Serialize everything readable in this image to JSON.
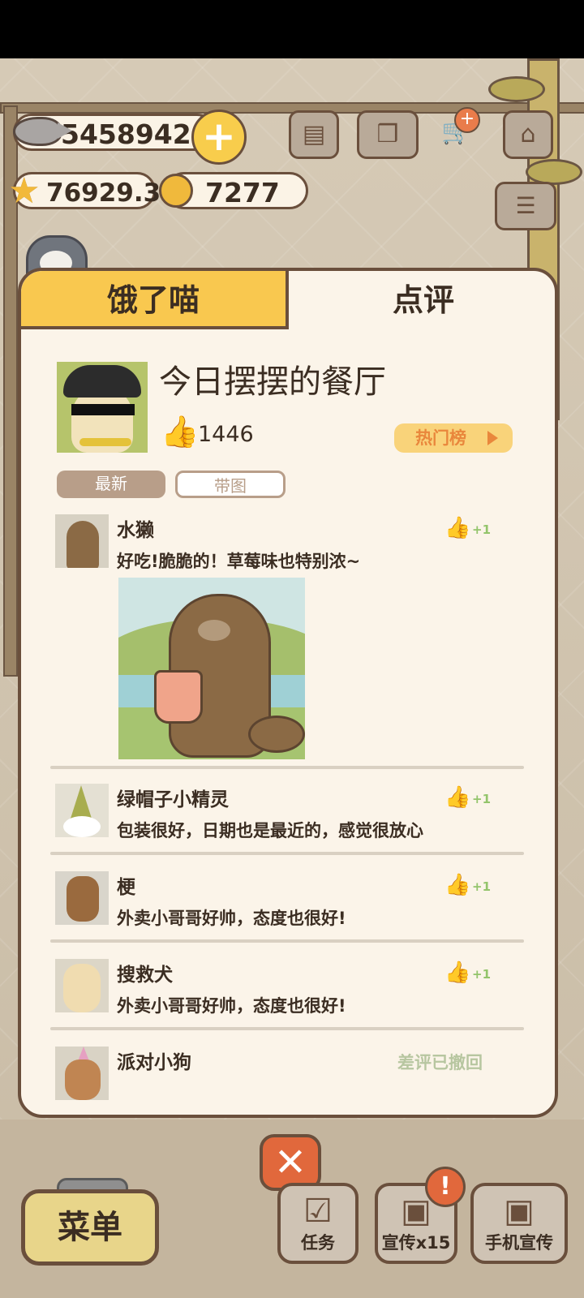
{
  "currency": {
    "fish": "5458942",
    "stars": "76929.3",
    "bells": "7277"
  },
  "tabs": {
    "left": "饿了喵",
    "right": "点评"
  },
  "restaurant": {
    "name": "今日摆摆的餐厅",
    "likes": "1446",
    "hot_list": "热门榜"
  },
  "filters": {
    "latest": "最新",
    "with_image": "带图"
  },
  "reviews": [
    {
      "name": "水獭",
      "text": "好吃!脆脆的！草莓味也特别浓~",
      "like": "+1",
      "has_photo": true
    },
    {
      "name": "绿帽子小精灵",
      "text": "包装很好，日期也是最近的，感觉很放心",
      "like": "+1"
    },
    {
      "name": "梗",
      "text": "外卖小哥哥好帅，态度也很好!",
      "like": "+1"
    },
    {
      "name": "搜救犬",
      "text": "外卖小哥哥好帅，态度也很好!",
      "like": "+1"
    },
    {
      "name": "派对小狗",
      "status": "差评已撤回"
    }
  ],
  "bottom": {
    "menu": "菜单",
    "task": "任务",
    "promote": "宣传x15",
    "phone_promote": "手机宣传",
    "alert": "!"
  },
  "icons": {
    "fish": "fish-icon",
    "plus": "plus-icon",
    "star": "star-icon",
    "bell": "bell-icon",
    "close": "close-icon",
    "thumb": "thumbs-up-icon"
  },
  "colors": {
    "panel_bg": "#fbf4e9",
    "tab_active": "#f9c84f",
    "outline": "#6a4f3c",
    "like_green": "#93c46b",
    "hot_orange": "#e9873c"
  }
}
